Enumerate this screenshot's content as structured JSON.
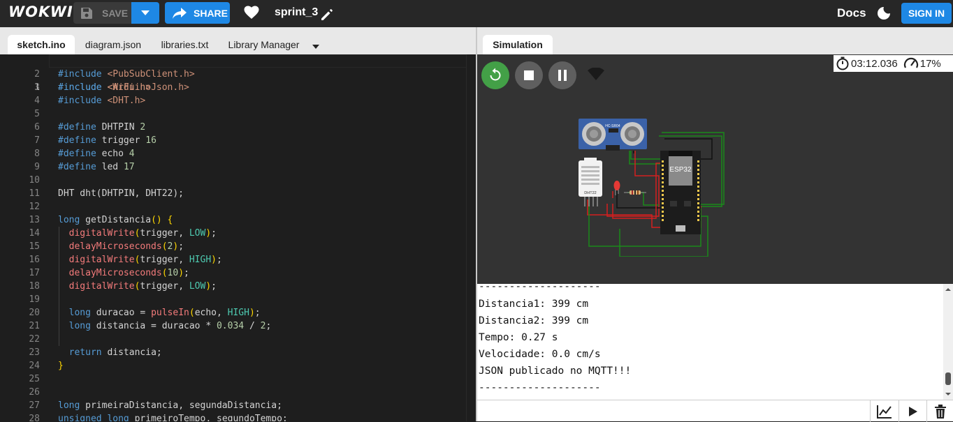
{
  "app": {
    "logo": "WOKWI"
  },
  "toolbar": {
    "save_label": "SAVE",
    "share_label": "SHARE",
    "project_name": "sprint_3",
    "docs_label": "Docs",
    "signin_label": "SIGN IN"
  },
  "editor_tabs": [
    "sketch.ino",
    "diagram.json",
    "libraries.txt",
    "Library Manager"
  ],
  "active_editor_tab": "sketch.ino",
  "sim_tab": "Simulation",
  "sim": {
    "elapsed_time": "03:12.036",
    "speed": "17%",
    "sensor_label": "HC-SR04",
    "board_label": "ESP32",
    "dht_label": "DHT22"
  },
  "code_lines": [
    "#include <WiFi.h>",
    "#include <PubSubClient.h>",
    "#include <ArduinoJson.h>",
    "#include <DHT.h>",
    "",
    "#define DHTPIN 2",
    "#define trigger 16",
    "#define echo 4",
    "#define led 17",
    "",
    "DHT dht(DHTPIN, DHT22);",
    "",
    "long getDistancia() {",
    "  digitalWrite(trigger, LOW);",
    "  delayMicroseconds(2);",
    "  digitalWrite(trigger, HIGH);",
    "  delayMicroseconds(10);",
    "  digitalWrite(trigger, LOW);",
    "",
    "  long duracao = pulseIn(echo, HIGH);",
    "  long distancia = duracao * 0.034 / 2;",
    "",
    "  return distancia;",
    "}",
    "",
    "",
    "long primeiraDistancia, segundaDistancia;",
    "unsigned long primeiroTempo, segundoTempo;"
  ],
  "serial_lines": [
    "--------------------",
    "Distancia1: 399 cm",
    "Distancia2: 399 cm",
    "Tempo: 0.27 s",
    "Velocidade: 0.0 cm/s",
    "JSON publicado no MQTT!!!",
    "--------------------"
  ],
  "colors": {
    "accent": "#1e88e5",
    "play_green": "#43a047",
    "control_grey": "#5f5f5f"
  }
}
